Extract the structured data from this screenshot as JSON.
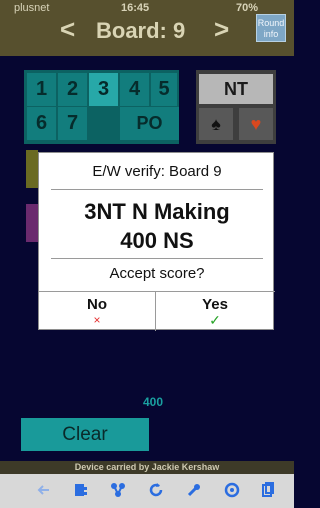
{
  "status_bar": {
    "carrier": "plusnet",
    "time": "16:45",
    "battery": "70%"
  },
  "header": {
    "prev": "<",
    "title": "Board: 9",
    "next": ">",
    "round_info": "Round info"
  },
  "levels": [
    "1",
    "2",
    "3",
    "4",
    "5",
    "6",
    "7"
  ],
  "selected_level": "3",
  "po_label": "PO",
  "nt_label": "NT",
  "suits": {
    "spade": "♠",
    "heart": "♥"
  },
  "dialog": {
    "title": "E/W verify: Board 9",
    "contract": "3NT N Making",
    "score": "400 NS",
    "question": "Accept score?",
    "no_label": "No",
    "no_mark": "×",
    "yes_label": "Yes",
    "yes_mark": "✓"
  },
  "score_small": "400",
  "clear_label": "Clear",
  "device_text": "Device carried by Jackie Kershaw",
  "colors": {
    "header": "#57502e",
    "background": "#060631",
    "teal": "#199a9a",
    "toolbar_icon": "#2b6de0"
  }
}
